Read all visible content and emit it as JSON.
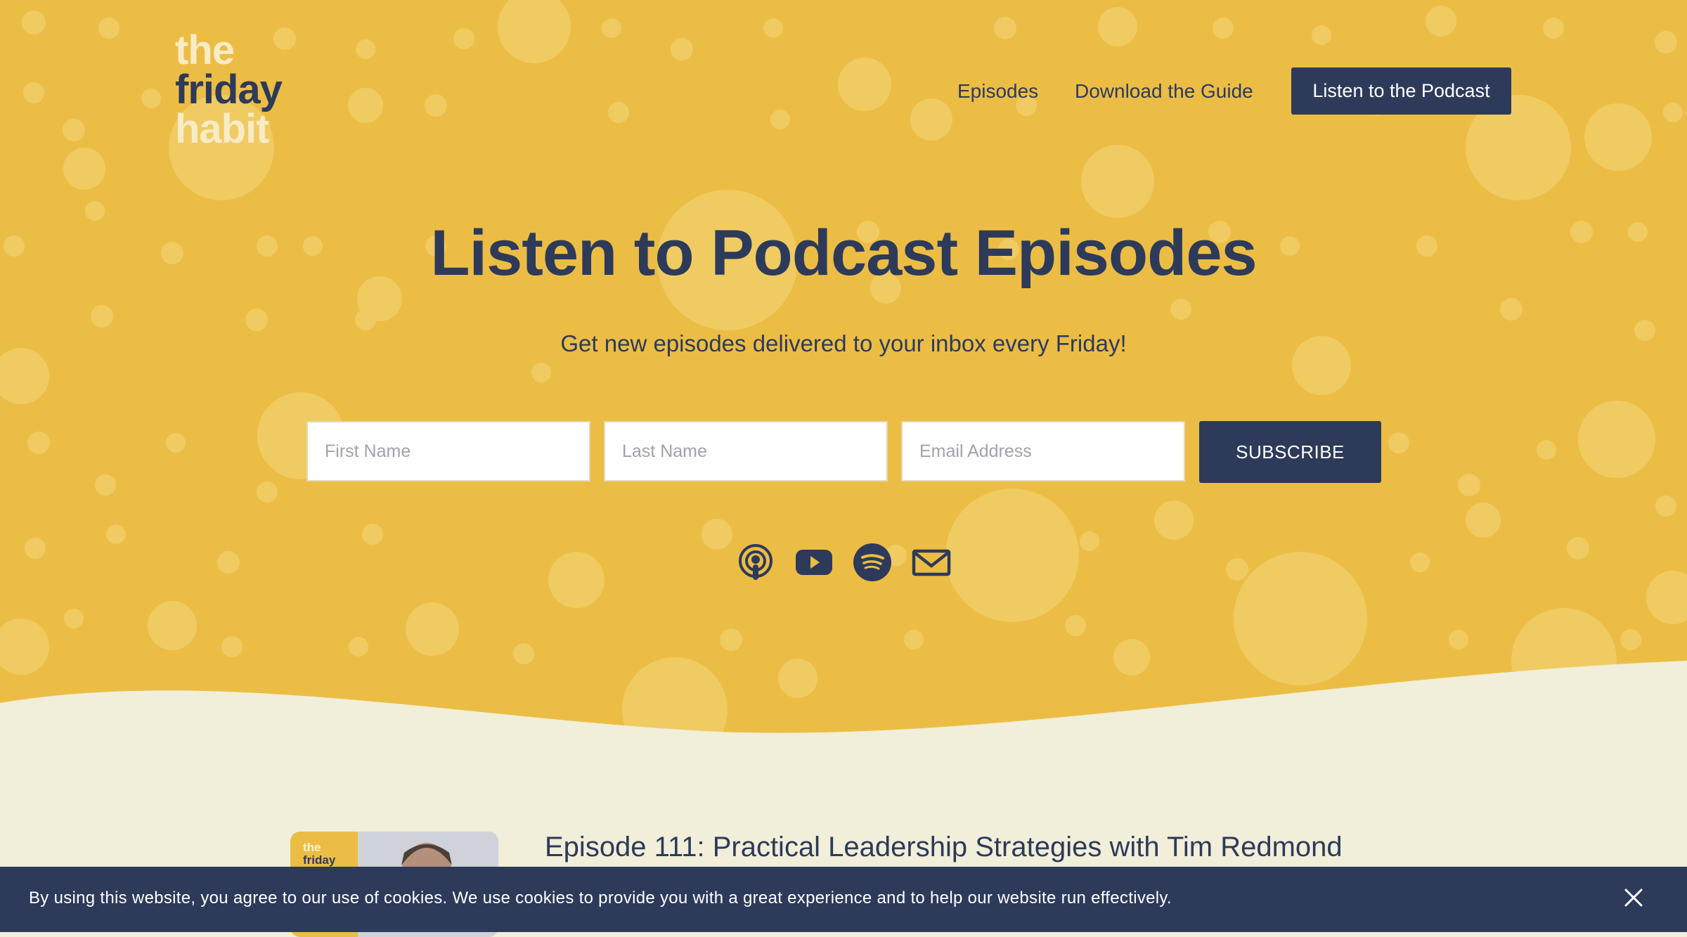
{
  "brand": {
    "logo_line1": "the",
    "logo_line2": "friday",
    "logo_line3": "habit"
  },
  "nav": {
    "items": [
      {
        "label": "Episodes"
      },
      {
        "label": "Download the Guide"
      }
    ],
    "cta_label": "Listen to the Podcast"
  },
  "hero": {
    "title": "Listen to Podcast Episodes",
    "subtitle": "Get new episodes delivered to your inbox every Friday!"
  },
  "form": {
    "first_name_placeholder": "First Name",
    "last_name_placeholder": "Last Name",
    "email_placeholder": "Email Address",
    "submit_label": "SUBSCRIBE"
  },
  "social": [
    "apple-podcasts-icon",
    "youtube-icon",
    "spotify-icon",
    "email-icon"
  ],
  "episode": {
    "thumb_line1": "the",
    "thumb_line2": "friday",
    "title": "Episode 111: Practical Leadership Strategies with Tim Redmond"
  },
  "cookie": {
    "text": "By using this website, you agree to our use of cookies. We use cookies to provide you with a great experience and to help our website run effectively."
  },
  "colors": {
    "hero_yellow": "#ecbd45",
    "dot_yellow": "#f0cb62",
    "navy": "#2d3a5a",
    "cream": "#f1efd9"
  }
}
